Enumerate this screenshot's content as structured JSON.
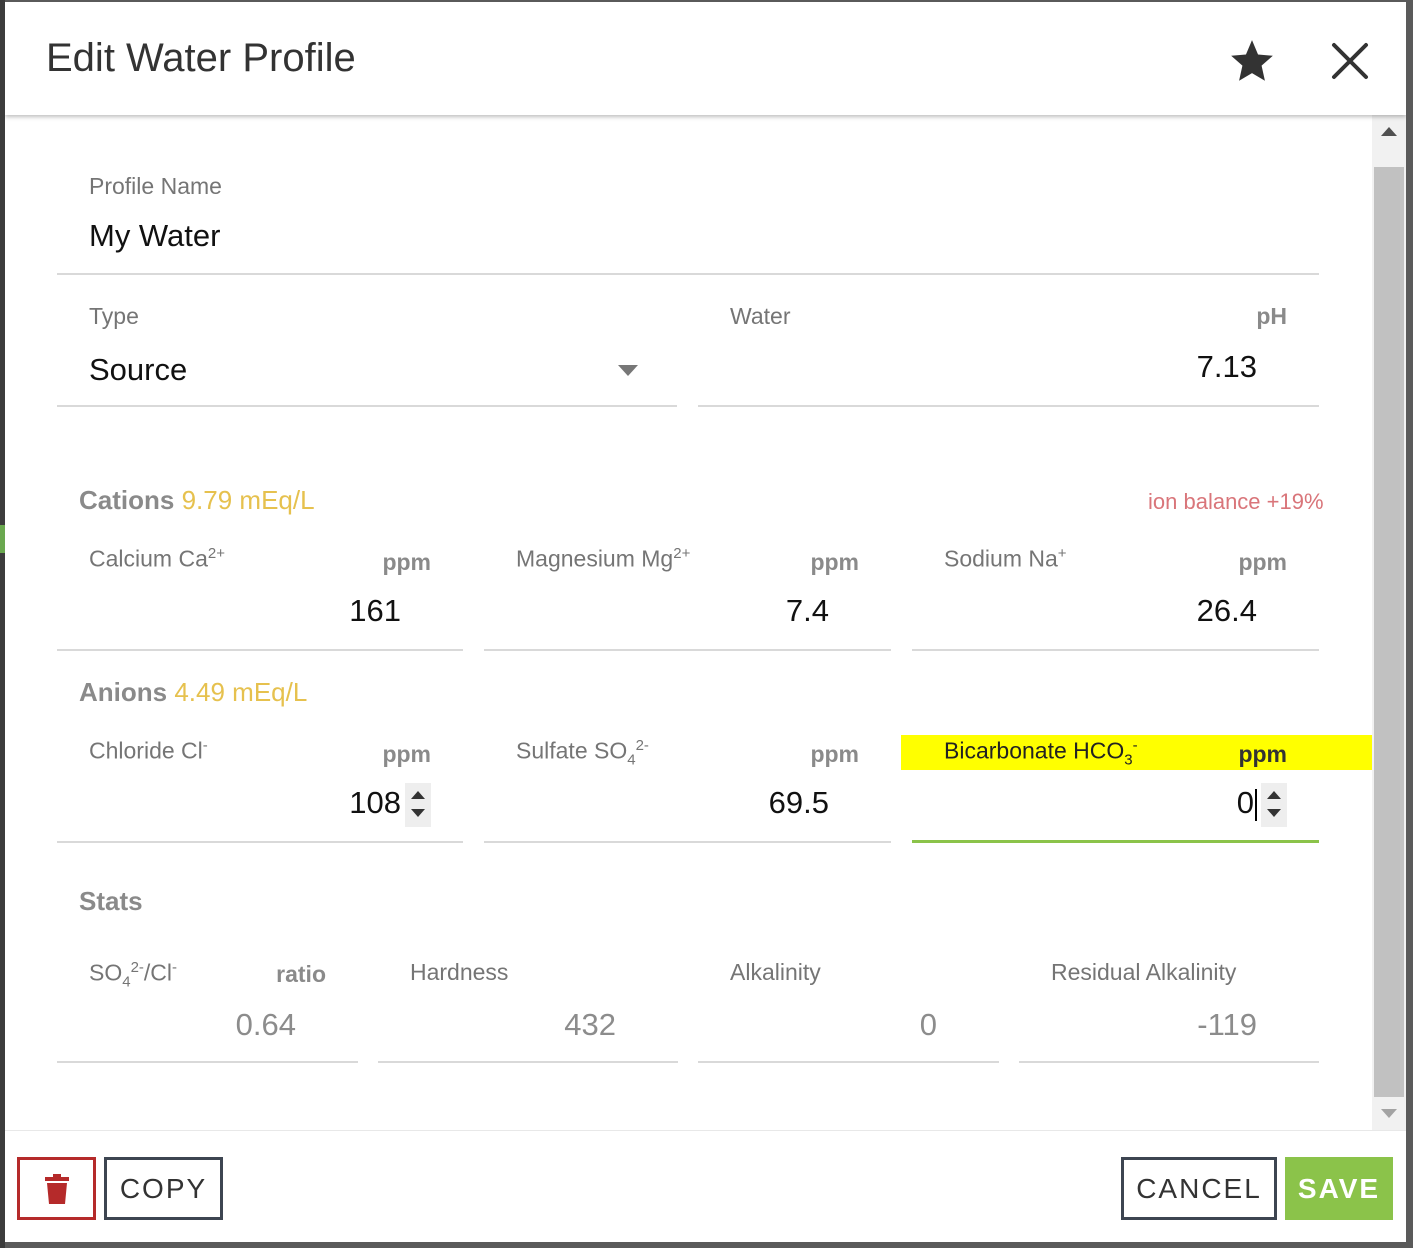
{
  "dialog": {
    "title": "Edit Water Profile"
  },
  "profile_name": {
    "label": "Profile Name",
    "value": "My Water"
  },
  "type": {
    "label": "Type",
    "value": "Source"
  },
  "water_ph": {
    "label": "Water",
    "unit": "pH",
    "value": "7.13"
  },
  "cations": {
    "title": "Cations",
    "meq": "9.79 mEq/L",
    "ion_balance": "ion balance +19%",
    "calcium": {
      "label": "Calcium Ca",
      "charge": "2+",
      "unit": "ppm",
      "value": "161"
    },
    "magnesium": {
      "label": "Magnesium Mg",
      "charge": "2+",
      "unit": "ppm",
      "value": "7.4"
    },
    "sodium": {
      "label": "Sodium Na",
      "charge": "+",
      "unit": "ppm",
      "value": "26.4"
    }
  },
  "anions": {
    "title": "Anions",
    "meq": "4.49 mEq/L",
    "chloride": {
      "label": "Chloride Cl",
      "charge": "-",
      "unit": "ppm",
      "value": "108"
    },
    "sulfate": {
      "label": "Sulfate SO",
      "sub": "4",
      "charge": "2-",
      "unit": "ppm",
      "value": "69.5"
    },
    "bicarbonate": {
      "label": "Bicarbonate HCO",
      "sub": "3",
      "charge": "-",
      "unit": "ppm",
      "value": "0"
    }
  },
  "stats": {
    "title": "Stats",
    "ratio": {
      "label_a": "SO",
      "sub": "4",
      "charge_a": "2-",
      "label_b": "/Cl",
      "charge_b": "-",
      "unit": "ratio",
      "value": "0.64"
    },
    "hardness": {
      "label": "Hardness",
      "value": "432"
    },
    "alkalinity": {
      "label": "Alkalinity",
      "value": "0"
    },
    "residual": {
      "label": "Residual Alkalinity",
      "value": "-119"
    }
  },
  "footer": {
    "copy": "COPY",
    "cancel": "CANCEL",
    "save": "SAVE"
  },
  "colors": {
    "accent_green": "#8bc34a",
    "meq_yellow": "#e6c14e",
    "ion_balance_red": "#d9757a",
    "delete_red": "#b52a2a",
    "highlight": "#ffff00"
  }
}
